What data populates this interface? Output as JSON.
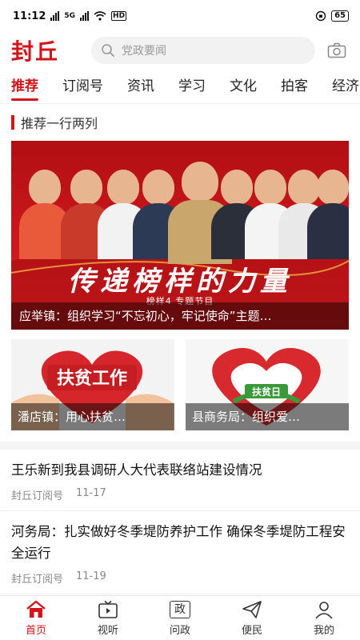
{
  "status_bar": {
    "time": "11:12",
    "network_left": "5G",
    "network_right": "HD",
    "battery": "65"
  },
  "header": {
    "logo": "封丘",
    "search_placeholder": "党政要闻"
  },
  "tabs": [
    {
      "label": "推荐",
      "active": true
    },
    {
      "label": "订阅号"
    },
    {
      "label": "资讯"
    },
    {
      "label": "学习"
    },
    {
      "label": "文化"
    },
    {
      "label": "拍客"
    },
    {
      "label": "经济"
    }
  ],
  "section": {
    "title": "推荐一行两列"
  },
  "hero": {
    "slogan": "传递榜样的力量",
    "subtitle": "榜样4 专题节目",
    "caption": "应举镇：组织学习“不忘初心，牢记使命”主题…"
  },
  "cards": [
    {
      "image_text": "扶贫工作",
      "caption": "潘店镇：用心扶贫…"
    },
    {
      "image_text": "扶贫日",
      "caption": "县商务局：组织爱…"
    }
  ],
  "news": [
    {
      "title": "王乐新到我县调研人大代表联络站建设情况",
      "source": "封丘订阅号",
      "date": "11-17"
    },
    {
      "title": "河务局：扎实做好冬季堤防养护工作 确保冬季堤防工程安全运行",
      "source": "封丘订阅号",
      "date": "11-19"
    }
  ],
  "bottom_nav": [
    {
      "label": "首页",
      "icon": "home-icon",
      "active": true
    },
    {
      "label": "视听",
      "icon": "tv-icon"
    },
    {
      "label": "问政",
      "icon": "government-icon",
      "glyph": "政"
    },
    {
      "label": "便民",
      "icon": "paper-plane-icon"
    },
    {
      "label": "我的",
      "icon": "user-icon"
    }
  ],
  "colors": {
    "brand_red": "#d2141a"
  }
}
